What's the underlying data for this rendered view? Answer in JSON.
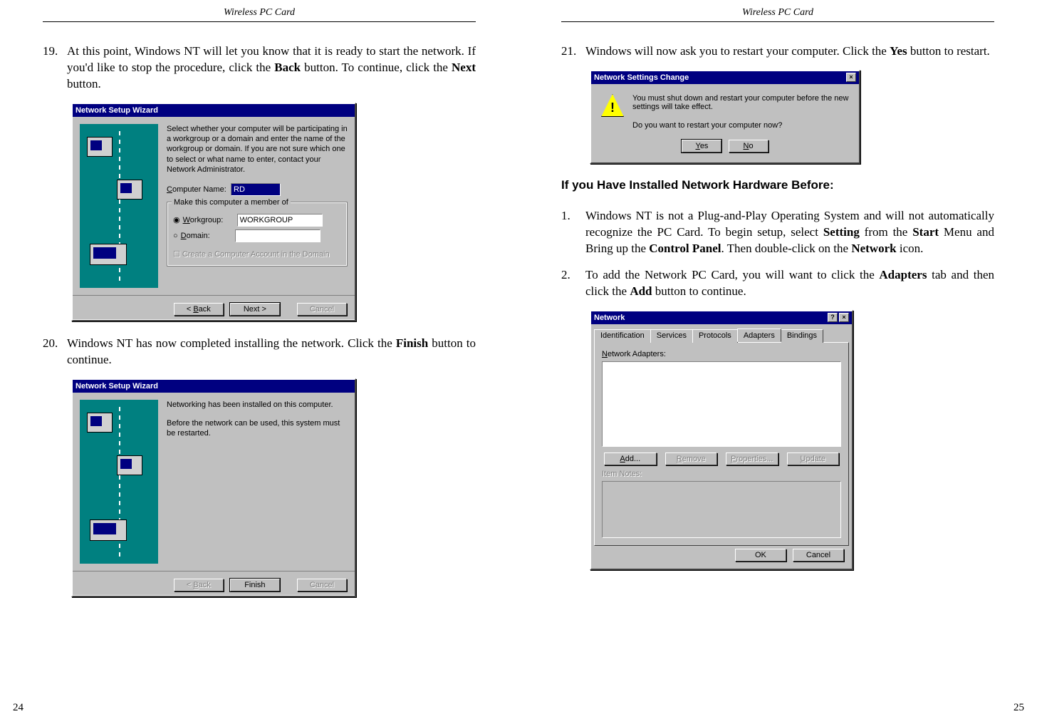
{
  "left": {
    "header": "Wireless  PC  Card",
    "page_number": "24",
    "step19": {
      "num": "19.",
      "text_before_bold1": "At this point, Windows NT will let you know that it is ready to start the network. If you'd like to stop the procedure, click the ",
      "bold1": "Back",
      "text_mid": " button. To continue, click the ",
      "bold2": "Next",
      "text_after": " button."
    },
    "wiz1": {
      "title": "Network Setup Wizard",
      "desc": "Select whether your computer will be participating in a workgroup or a domain and enter the name of the workgroup or domain. If you are not sure which one to select or what name to enter, contact your Network Administrator.",
      "computer_name_label": "Computer Name:",
      "computer_name_value": "RD",
      "group_label": "Make this computer a member of",
      "workgroup_label": "Workgroup:",
      "workgroup_value": "WORKGROUP",
      "domain_label": "Domain:",
      "domain_check": "Create a Computer Account in the Domain",
      "back": "< Back",
      "next": "Next >",
      "cancel": "Cancel"
    },
    "step20": {
      "num": "20.",
      "text_before": "Windows NT has now completed installing the network. Click the ",
      "bold": "Finish",
      "text_after": " button to continue."
    },
    "wiz2": {
      "title": "Network Setup Wizard",
      "line1": "Networking has been installed on this computer.",
      "line2": "Before the network can be used, this system must be restarted.",
      "back": "< Back",
      "finish": "Finish",
      "cancel": "Cancel"
    }
  },
  "right": {
    "header": "Wireless  PC  Card",
    "page_number": "25",
    "step21": {
      "num": "21.",
      "text_before": "Windows will now ask you to restart your computer. Click the ",
      "bold": "Yes",
      "text_after": " button to restart."
    },
    "msgbox": {
      "title": "Network Settings Change",
      "line1": "You must shut down and restart your computer before the new settings will take effect.",
      "line2": "Do you want to restart your computer now?",
      "yes": "Yes",
      "no": "No"
    },
    "section_heading": "If you Have Installed Network Hardware Before:",
    "step1": {
      "num": "1.",
      "t1": "Windows NT is not a Plug-and-Play Operating System and will not automatically recognize the PC Card. To begin setup, select ",
      "b1": "Setting",
      "t2": " from the ",
      "b2": "Start",
      "t3": " Menu and Bring up the ",
      "b3": "Control Panel",
      "t4": ". Then double-click on the ",
      "b4": "Network",
      "t5": " icon."
    },
    "step2": {
      "num": "2.",
      "t1": "To add the Network PC Card, you will want to click the ",
      "b1": "Adapters",
      "t2": " tab and then click the ",
      "b2": "Add",
      "t3": " button to continue."
    },
    "netdlg": {
      "title": "Network",
      "tabs": [
        "Identification",
        "Services",
        "Protocols",
        "Adapters",
        "Bindings"
      ],
      "active_tab": "Adapters",
      "adapters_label": "Network Adapters:",
      "add": "Add...",
      "remove": "Remove",
      "properties": "Properties...",
      "update": "Update",
      "item_notes_label": "Item Notes:",
      "ok": "OK",
      "cancel": "Cancel"
    }
  }
}
